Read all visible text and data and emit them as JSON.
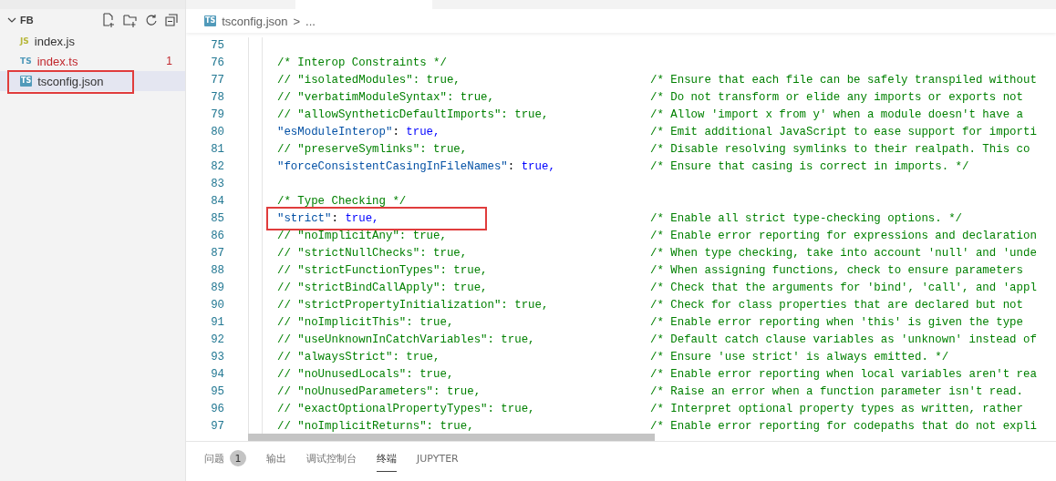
{
  "explorer": {
    "folder": "FB",
    "expanded": true,
    "files": [
      {
        "name": "index.js",
        "icon": "JS",
        "kind": "js",
        "selected": false,
        "error": false,
        "annotated": false
      },
      {
        "name": "index.ts",
        "icon": "TS",
        "kind": "ts",
        "selected": false,
        "error": true,
        "badge": "1",
        "annotated": false
      },
      {
        "name": "tsconfig.json",
        "icon": "TS",
        "kind": "config",
        "selected": true,
        "error": false,
        "annotated": true
      }
    ]
  },
  "breadcrumb": {
    "icon": "TS",
    "file": "tsconfig.json",
    "separator": ">",
    "more": "..."
  },
  "lines": [
    {
      "number": "75",
      "kind": "blank"
    },
    {
      "number": "76",
      "kind": "section",
      "text": "/* Interop Constraints */"
    },
    {
      "number": "77",
      "kind": "setting",
      "commented": true,
      "code": "// \"isolatedModules\": true,",
      "comment": "/* Ensure that each file can be safely transpiled without"
    },
    {
      "number": "78",
      "kind": "setting",
      "commented": true,
      "code": "// \"verbatimModuleSyntax\": true,",
      "comment": "/* Do not transform or elide any imports or exports not"
    },
    {
      "number": "79",
      "kind": "setting",
      "commented": true,
      "code": "// \"allowSyntheticDefaultImports\": true,",
      "comment": "/* Allow 'import x from y' when a module doesn't have a"
    },
    {
      "number": "80",
      "kind": "setting",
      "commented": false,
      "code": "\"esModuleInterop\": true,",
      "comment": "/* Emit additional JavaScript to ease support for importi"
    },
    {
      "number": "81",
      "kind": "setting",
      "commented": true,
      "code": "// \"preserveSymlinks\": true,",
      "comment": "/* Disable resolving symlinks to their realpath. This co"
    },
    {
      "number": "82",
      "kind": "setting",
      "commented": false,
      "code": "\"forceConsistentCasingInFileNames\": true,",
      "comment": "/* Ensure that casing is correct in imports. */"
    },
    {
      "number": "83",
      "kind": "blank"
    },
    {
      "number": "84",
      "kind": "section",
      "text": "/* Type Checking */"
    },
    {
      "number": "85",
      "kind": "setting",
      "commented": false,
      "annotated": true,
      "code": "\"strict\": true,",
      "comment": "/* Enable all strict type-checking options. */"
    },
    {
      "number": "86",
      "kind": "setting",
      "commented": true,
      "code": "// \"noImplicitAny\": true,",
      "comment": "/* Enable error reporting for expressions and declaration"
    },
    {
      "number": "87",
      "kind": "setting",
      "commented": true,
      "code": "// \"strictNullChecks\": true,",
      "comment": "/* When type checking, take into account 'null' and 'unde"
    },
    {
      "number": "88",
      "kind": "setting",
      "commented": true,
      "code": "// \"strictFunctionTypes\": true,",
      "comment": "/* When assigning functions, check to ensure parameters"
    },
    {
      "number": "89",
      "kind": "setting",
      "commented": true,
      "code": "// \"strictBindCallApply\": true,",
      "comment": "/* Check that the arguments for 'bind', 'call', and 'appl"
    },
    {
      "number": "90",
      "kind": "setting",
      "commented": true,
      "code": "// \"strictPropertyInitialization\": true,",
      "comment": "/* Check for class properties that are declared but not"
    },
    {
      "number": "91",
      "kind": "setting",
      "commented": true,
      "code": "// \"noImplicitThis\": true,",
      "comment": "/* Enable error reporting when 'this' is given the type"
    },
    {
      "number": "92",
      "kind": "setting",
      "commented": true,
      "code": "// \"useUnknownInCatchVariables\": true,",
      "comment": "/* Default catch clause variables as 'unknown' instead of"
    },
    {
      "number": "93",
      "kind": "setting",
      "commented": true,
      "code": "// \"alwaysStrict\": true,",
      "comment": "/* Ensure 'use strict' is always emitted. */"
    },
    {
      "number": "94",
      "kind": "setting",
      "commented": true,
      "code": "// \"noUnusedLocals\": true,",
      "comment": "/* Enable error reporting when local variables aren't rea"
    },
    {
      "number": "95",
      "kind": "setting",
      "commented": true,
      "code": "// \"noUnusedParameters\": true,",
      "comment": "/* Raise an error when a function parameter isn't read."
    },
    {
      "number": "96",
      "kind": "setting",
      "commented": true,
      "code": "// \"exactOptionalPropertyTypes\": true,",
      "comment": "/* Interpret optional property types as written, rather"
    },
    {
      "number": "97",
      "kind": "setting",
      "commented": true,
      "code": "// \"noImplicitReturns\": true,",
      "comment": "/* Enable error reporting for codepaths that do not expli"
    }
  ],
  "panel_tabs": [
    {
      "label": "问题",
      "badge": "1",
      "selected": false
    },
    {
      "label": "输出",
      "selected": false
    },
    {
      "label": "调试控制台",
      "selected": false
    },
    {
      "label": "终端",
      "selected": true
    },
    {
      "label": "JUPYTER",
      "selected": false
    }
  ]
}
